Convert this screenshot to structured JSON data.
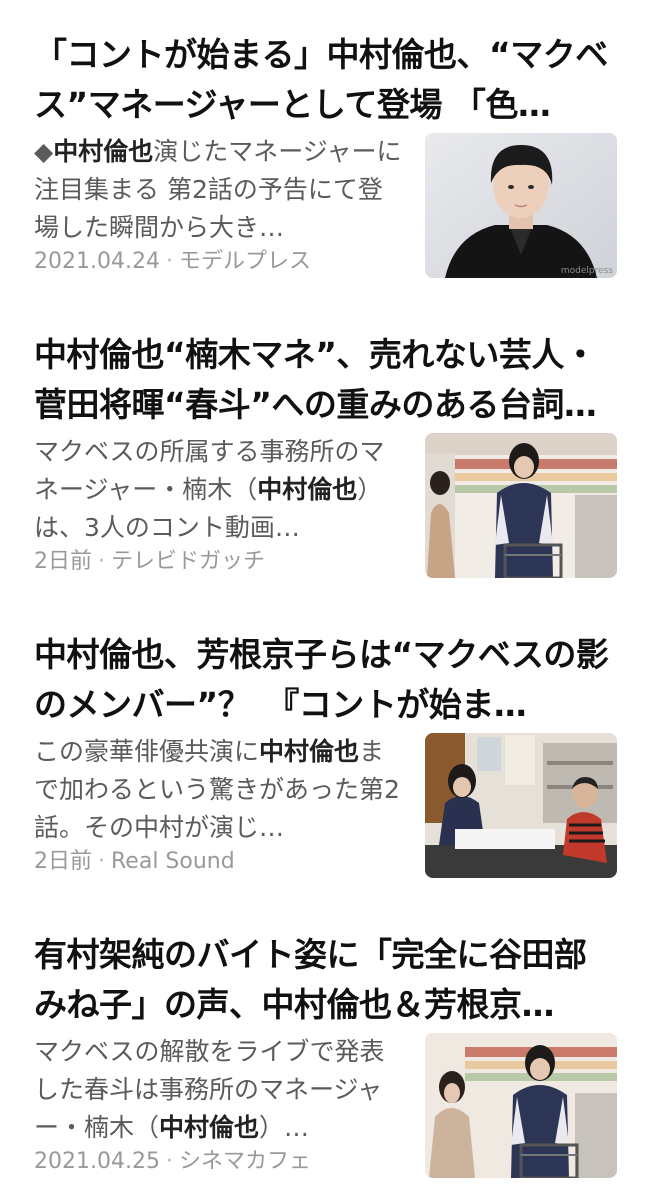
{
  "articles": [
    {
      "headline": "「コントが始まる」中村倫也、“マクベス”マネージャーとして登場 「色…",
      "snippet_prefix": "◆",
      "snippet_highlight": "中村倫也",
      "snippet_rest": "演じたマネージャーに注目集まる 第2話の予告にて登場した瞬間から大き…",
      "date": "2021.04.24",
      "source": "モデルプレス",
      "image_caption": "modelpress",
      "image_icon": "portrait-photo"
    },
    {
      "headline": "中村倫也“楠木マネ”、売れない芸人・菅田将暉“春斗”への重みのある台詞…",
      "snippet_before": "マクベスの所属する事務所のマネージャー・楠木（",
      "snippet_highlight": "中村倫也",
      "snippet_after": "）は、3人のコント動画…",
      "date": "2日前",
      "source": "テレビドガッチ",
      "image_icon": "supermarket-scene-photo"
    },
    {
      "headline": "中村倫也、芳根京子らは“マクベスの影のメンバー”？　『コントが始ま…",
      "snippet_before": "この豪華俳優共演に",
      "snippet_highlight": "中村倫也",
      "snippet_after": "まで加わるという驚きがあった第2話。その中村が演じ…",
      "date": "2日前",
      "source": "Real Sound",
      "image_icon": "office-scene-photo"
    },
    {
      "headline": "有村架純のバイト姿に「完全に谷田部みね子」の声、中村倫也＆芳根京…",
      "snippet_before": "マクベスの解散をライブで発表した春斗は事務所のマネージャー・楠木（",
      "snippet_highlight": "中村倫也",
      "snippet_after": "）…",
      "date": "2021.04.25",
      "source": "シネマカフェ",
      "image_icon": "supermarket-scene-photo"
    }
  ],
  "separator": "·"
}
